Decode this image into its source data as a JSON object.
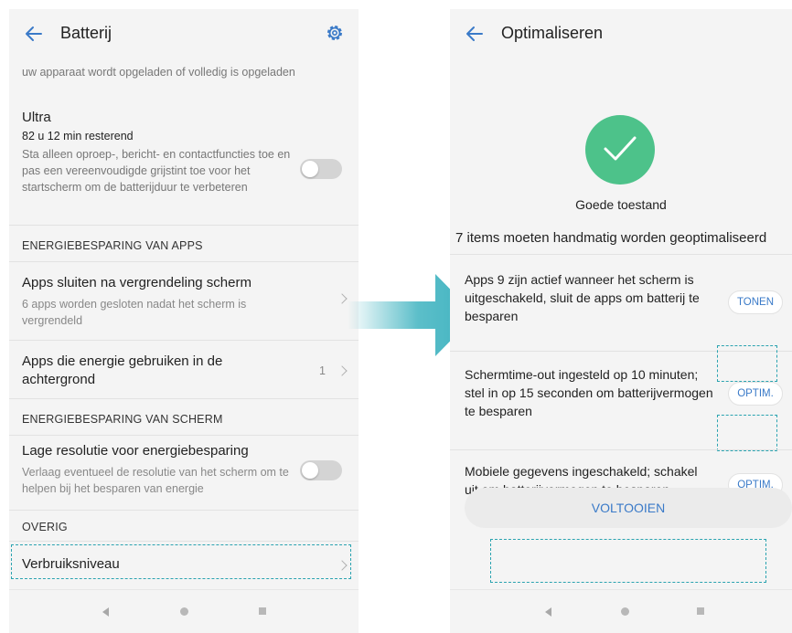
{
  "left_screen": {
    "title": "Batterij",
    "intro": "uw apparaat wordt opgeladen of volledig is opgeladen",
    "ultra": {
      "title": "Ultra",
      "remaining": "82 u 12 min resterend",
      "description": "Sta alleen oproep-, bericht- en contactfuncties toe en pas een vereenvoudigde grijstint toe voor het startscherm om de batterijduur te verbeteren",
      "toggle_on": false
    },
    "section_apps": "ENERGIEBESPARING VAN APPS",
    "item_close_apps": {
      "title": "Apps sluiten na vergrendeling scherm",
      "description": "6 apps worden gesloten nadat het scherm is vergrendeld"
    },
    "item_background": {
      "title": "Apps die energie gebruiken in de achtergrond",
      "count": "1"
    },
    "section_screen": "ENERGIEBESPARING VAN SCHERM",
    "item_low_res": {
      "title": "Lage resolutie voor energiebesparing",
      "description": "Verlaag eventueel de resolutie van het scherm om te helpen bij het besparen van energie",
      "toggle_on": false
    },
    "section_other": "OVERIG",
    "item_usage": {
      "title": "Verbruiksniveau"
    }
  },
  "right_screen": {
    "title": "Optimaliseren",
    "status": "Goede toestand",
    "items_heading": "7 items moeten handmatig worden geoptimaliseerd",
    "items": [
      {
        "text": "Apps 9 zijn actief wanneer het scherm is uitgeschakeld, sluit de apps om batterij te besparen",
        "button": "TONEN"
      },
      {
        "text": "Schermtime-out ingesteld op 10 minuten; stel in op 15 seconden om batterijvermogen te besparen",
        "button": "OPTIM."
      },
      {
        "text": "Mobiele gegevens ingeschakeld; schakel uit om batterijvermogen te besparen",
        "button": "OPTIM."
      }
    ],
    "done_button": "VOLTOOIEN"
  },
  "colors": {
    "accent": "#3a7ac8",
    "check_green": "#4dc28a",
    "highlight_dash": "#2aa3b0",
    "arrow": "#3fb3c0"
  }
}
